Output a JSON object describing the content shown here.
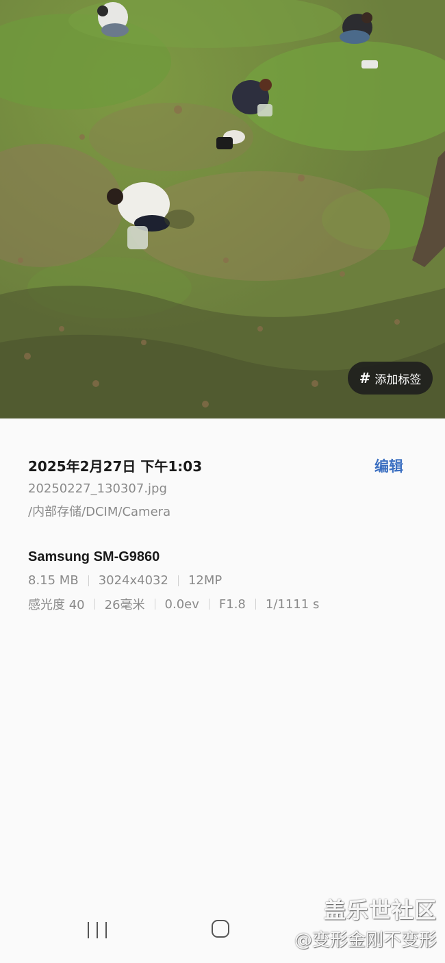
{
  "photo": {
    "tag_button_label": "添加标签",
    "tag_icon": "hash-icon"
  },
  "info": {
    "datetime": "2025年2月27日 下午1:03",
    "edit_label": "编辑",
    "filename": "20250227_130307.jpg",
    "path": "/内部存储/DCIM/Camera",
    "device": "Samsung SM-G9860",
    "specs_row1": [
      "8.15 MB",
      "3024x4032",
      "12MP"
    ],
    "specs_row2": [
      "感光度 40",
      "26毫米",
      "0.0ev",
      "F1.8",
      "1/1111 s"
    ]
  },
  "colors": {
    "accent": "#3b6fc1",
    "background": "#fafafa",
    "primary_text": "#1a1a1a",
    "secondary_text": "#8a8a8a"
  },
  "navbar": {
    "recents_icon": "recents-icon",
    "home_icon": "home-icon"
  },
  "watermark": {
    "title": "盖乐世社区",
    "author": "@变形金刚不变形"
  }
}
